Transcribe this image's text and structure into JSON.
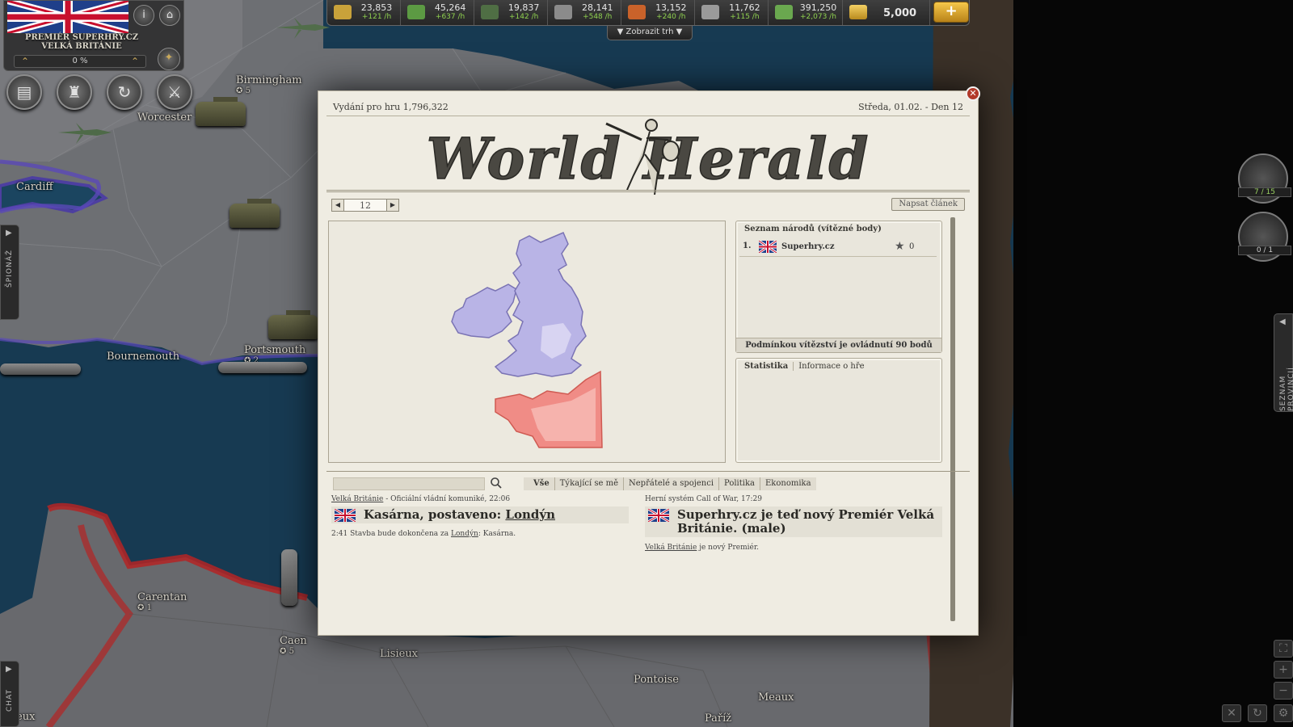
{
  "player": {
    "title_line1": "PREMIÉR SUPERHRY.CZ",
    "title_line2": "VELKÁ BRITÁNIE",
    "progress": "0 %"
  },
  "resources": [
    {
      "icon": "supplies-icon",
      "amount": "23,853",
      "rate": "+121 /h",
      "color": "#c9a23a"
    },
    {
      "icon": "components-icon",
      "amount": "45,264",
      "rate": "+637 /h",
      "color": "#5c9a43"
    },
    {
      "icon": "manpower-icon",
      "amount": "19,837",
      "rate": "+142 /h",
      "color": "#4f6e44"
    },
    {
      "icon": "steel-icon",
      "amount": "28,141",
      "rate": "+548 /h",
      "color": "#8b8b8b"
    },
    {
      "icon": "fuel-icon",
      "amount": "13,152",
      "rate": "+240 /h",
      "color": "#c9622a"
    },
    {
      "icon": "electronics-icon",
      "amount": "11,762",
      "rate": "+115 /h",
      "color": "#9a9a9a"
    },
    {
      "icon": "money-icon",
      "amount": "391,250",
      "rate": "+2,073 /h",
      "color": "#6aa84f"
    }
  ],
  "gold": {
    "amount": "5,000",
    "buy_label": "+"
  },
  "market_label": "Zobrazit trh",
  "map_cities": [
    {
      "name": "Birmingham",
      "vp": "5"
    },
    {
      "name": "Worcester",
      "vp": ""
    },
    {
      "name": "Cardiff",
      "vp": ""
    },
    {
      "name": "Bournemouth",
      "vp": ""
    },
    {
      "name": "Portsmouth",
      "vp": "2"
    },
    {
      "name": "Carentan",
      "vp": "1"
    },
    {
      "name": "Caen",
      "vp": "5"
    },
    {
      "name": "Lisieux",
      "vp": ""
    },
    {
      "name": "Pontoise",
      "vp": ""
    },
    {
      "name": "Meaux",
      "vp": ""
    },
    {
      "name": "Paříž",
      "vp": ""
    },
    {
      "name": "eux",
      "vp": ""
    }
  ],
  "side_tabs": {
    "spionaz": "ŠPIONÁŽ",
    "chat": "CHAT",
    "provinces": "SEZNAM PROVINCIÍ"
  },
  "queues": [
    {
      "label": "7 / 15"
    },
    {
      "label": "0 / 1"
    }
  ],
  "newspaper": {
    "edition": "Vydání pro hru 1,796,322",
    "date": "Středa, 01.02. - Den 12",
    "masthead": "World Herald",
    "page": "12",
    "write_article": "Napsat článek",
    "nations_header": "Seznam národů (vítězné body)",
    "nation_rank": "1.",
    "nation_name": "Superhry.cz",
    "nation_points": "0",
    "victory_condition": "Podmínkou vítězství je ovládnutí 90 bodů",
    "stats_tabs": [
      "Statistika",
      "Informace o hře"
    ],
    "search_placeholder": "",
    "filters": [
      "Vše",
      "Týkající se mě",
      "Nepřátelé a spojenci",
      "Politika",
      "Ekonomika"
    ],
    "articles": [
      {
        "meta_link": "Velká Británie",
        "meta_rest": " - Oficiální vládní komuniké, 22:06",
        "headline_pre": "Kasárna, postaveno: ",
        "headline_link": "Londýn",
        "body_pre": "2:41 Stavba bude dokončena za ",
        "body_link": "Londýn",
        "body_post": ": Kasárna."
      },
      {
        "meta_plain": "Herní systém Call of War, 17:29",
        "headline": "Superhry.cz je teď nový Premiér Velká Británie. (male)",
        "body_link": "Velká Británie",
        "body_post": " je nový Premiér."
      }
    ]
  },
  "colors": {
    "uk": "#b9b4e6",
    "france": "#f08c86",
    "paper": "#efece2"
  }
}
